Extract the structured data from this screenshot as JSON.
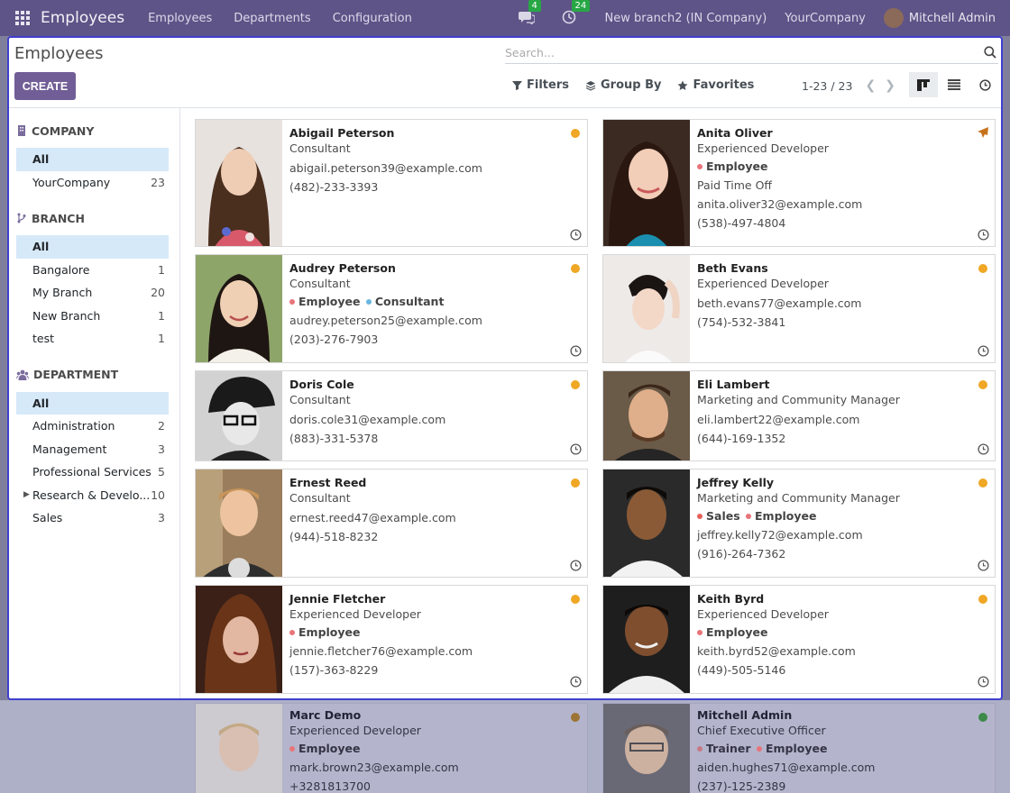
{
  "navbar": {
    "app_title": "Employees",
    "menu": [
      "Employees",
      "Departments",
      "Configuration"
    ],
    "messages_count": "4",
    "activities_count": "24",
    "branch": "New branch2 (IN Company)",
    "company": "YourCompany",
    "user": "Mitchell Admin"
  },
  "control_panel": {
    "title": "Employees",
    "create_label": "CREATE",
    "search_placeholder": "Search...",
    "filters_label": "Filters",
    "group_by_label": "Group By",
    "favorites_label": "Favorites",
    "pager": "1-23 / 23"
  },
  "sidebar": {
    "company": {
      "title": "COMPANY",
      "items": [
        {
          "label": "All",
          "count": ""
        },
        {
          "label": "YourCompany",
          "count": "23"
        }
      ]
    },
    "branch": {
      "title": "BRANCH",
      "items": [
        {
          "label": "All",
          "count": ""
        },
        {
          "label": "Bangalore",
          "count": "1"
        },
        {
          "label": "My Branch",
          "count": "20"
        },
        {
          "label": "New Branch",
          "count": "1"
        },
        {
          "label": "test",
          "count": "1"
        }
      ]
    },
    "department": {
      "title": "DEPARTMENT",
      "items": [
        {
          "label": "All",
          "count": ""
        },
        {
          "label": "Administration",
          "count": "2"
        },
        {
          "label": "Management",
          "count": "3"
        },
        {
          "label": "Professional Services",
          "count": "5"
        },
        {
          "label": "Research & Develo...",
          "count": "10"
        },
        {
          "label": "Sales",
          "count": "3"
        }
      ]
    }
  },
  "employees": [
    {
      "name": "Abigail Peterson",
      "job": "Consultant",
      "tags": [],
      "extra": "",
      "email": "abigail.peterson39@example.com",
      "phone": "(482)-233-3393",
      "status_color": "#f0a725"
    },
    {
      "name": "Anita Oliver",
      "job": "Experienced Developer",
      "tags": [
        "Employee"
      ],
      "extra": "Paid Time Off",
      "email": "anita.oliver32@example.com",
      "phone": "(538)-497-4804",
      "status_color": "#c7731d"
    },
    {
      "name": "Audrey Peterson",
      "job": "Consultant",
      "tags": [
        "Employee",
        "Consultant"
      ],
      "extra": "",
      "email": "audrey.peterson25@example.com",
      "phone": "(203)-276-7903",
      "status_color": "#f0a725"
    },
    {
      "name": "Beth Evans",
      "job": "Experienced Developer",
      "tags": [],
      "extra": "",
      "email": "beth.evans77@example.com",
      "phone": "(754)-532-3841",
      "status_color": "#f0a725"
    },
    {
      "name": "Doris Cole",
      "job": "Consultant",
      "tags": [],
      "extra": "",
      "email": "doris.cole31@example.com",
      "phone": "(883)-331-5378",
      "status_color": "#f0a725"
    },
    {
      "name": "Eli Lambert",
      "job": "Marketing and Community Manager",
      "tags": [],
      "extra": "",
      "email": "eli.lambert22@example.com",
      "phone": "(644)-169-1352",
      "status_color": "#f0a725"
    },
    {
      "name": "Ernest Reed",
      "job": "Consultant",
      "tags": [],
      "extra": "",
      "email": "ernest.reed47@example.com",
      "phone": "(944)-518-8232",
      "status_color": "#f0a725"
    },
    {
      "name": "Jeffrey Kelly",
      "job": "Marketing and Community Manager",
      "tags": [
        "Sales",
        "Employee"
      ],
      "extra": "",
      "email": "jeffrey.kelly72@example.com",
      "phone": "(916)-264-7362",
      "status_color": "#f0a725"
    },
    {
      "name": "Jennie Fletcher",
      "job": "Experienced Developer",
      "tags": [
        "Employee"
      ],
      "extra": "",
      "email": "jennie.fletcher76@example.com",
      "phone": "(157)-363-8229",
      "status_color": "#f0a725"
    },
    {
      "name": "Keith Byrd",
      "job": "Experienced Developer",
      "tags": [
        "Employee"
      ],
      "extra": "",
      "email": "keith.byrd52@example.com",
      "phone": "(449)-505-5146",
      "status_color": "#f0a725"
    },
    {
      "name": "Marc Demo",
      "job": "Experienced Developer",
      "tags": [
        "Employee"
      ],
      "extra": "",
      "email": "mark.brown23@example.com",
      "phone": "+3281813700",
      "status_color": "#9c7436"
    },
    {
      "name": "Mitchell Admin",
      "job": "Chief Executive Officer",
      "tags": [
        "Trainer",
        "Employee"
      ],
      "extra": "",
      "email": "aiden.hughes71@example.com",
      "phone": "(237)-125-2389",
      "status_color": "#3d8a4a"
    }
  ],
  "tag_colors": {
    "Employee": "#e8747a",
    "Consultant": "#6ab5e0",
    "Sales": "#e8605a",
    "Trainer": "#c77a86"
  },
  "accent_color": "#715e96"
}
